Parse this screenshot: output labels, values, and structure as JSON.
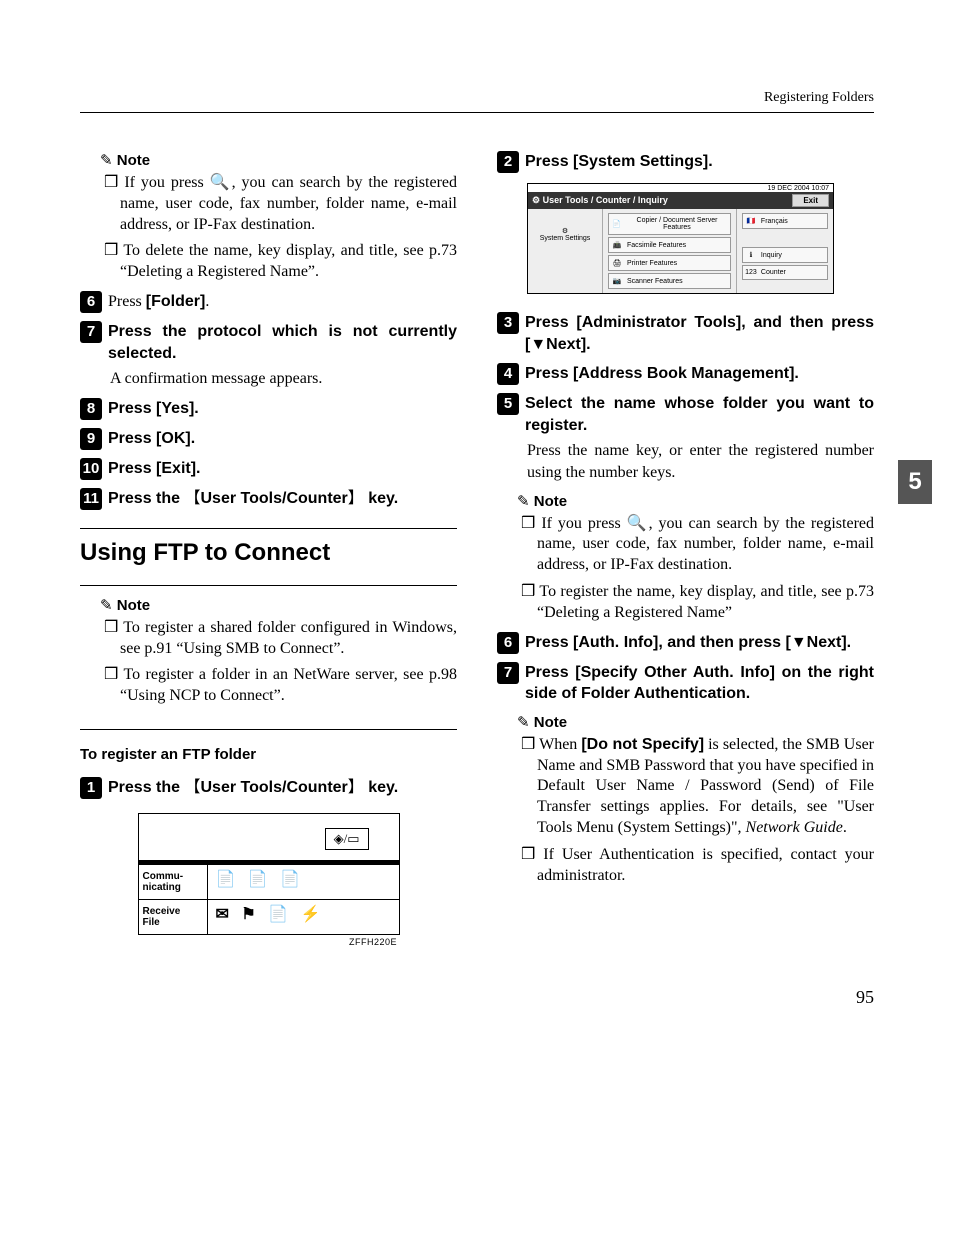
{
  "header": {
    "section": "Registering Folders"
  },
  "sideTab": "5",
  "pageNumber": "95",
  "left": {
    "note1": "Note",
    "note1_b1": "If you press 🔍, you can search by the registered name, user code, fax number, folder name, e-mail address, or IP-Fax destination.",
    "note1_b2": "To delete the name, key display, and title, see p.73 “Deleting a Registered Name”.",
    "s6": {
      "pre": "Press ",
      "btn": "[Folder]",
      "post": "."
    },
    "s7": "Press the protocol which is not currently selected.",
    "s7_after": "A confirmation message appears.",
    "s8": {
      "pre": "Press ",
      "btn": "[Yes]",
      "post": "."
    },
    "s9": {
      "pre": "Press ",
      "btn": "[OK]",
      "post": "."
    },
    "s10": {
      "pre": "Press ",
      "btn": "[Exit]",
      "post": "."
    },
    "s11": {
      "pre": "Press the ",
      "key": "User Tools/Counter",
      "post": " key."
    },
    "h2": "Using FTP to Connect",
    "note2": "Note",
    "note2_b1": "To register a shared folder configured in Windows, see p.91 “Using SMB to Connect”.",
    "note2_b2": "To register a folder in an NetWare server, see p.98 “Using NCP to Connect”.",
    "h3": "To register an FTP folder",
    "s1": {
      "pre": "Press the ",
      "key": "User Tools/Counter",
      "post": " key."
    },
    "illus": {
      "topbtn": "◈/▭",
      "row1_label": "Commu-\nnicating",
      "row1_icons": "📄 📄 📄",
      "row2_label": "Receive\nFile",
      "row2_icons": "✉ ⚑ 📄 ⚡",
      "caption": "ZFFH220E"
    }
  },
  "right": {
    "s2": {
      "pre": "Press ",
      "btn": "[System Settings]",
      "post": "."
    },
    "ss2": {
      "time": "19 DEC 2004 10:07",
      "title": "⚙ User Tools / Counter / Inquiry",
      "exit": "Exit",
      "left_label": "System Settings",
      "mid": [
        {
          "icon": "📄",
          "label": "Copier / Document Server Features"
        },
        {
          "icon": "📠",
          "label": "Facsimile Features"
        },
        {
          "icon": "🖨",
          "label": "Printer Features"
        },
        {
          "icon": "📷",
          "label": "Scanner Features"
        }
      ],
      "right": [
        {
          "icon": "🇫🇷",
          "label": "Français"
        },
        {
          "icon": "ℹ",
          "label": "Inquiry"
        },
        {
          "icon": "123",
          "label": "Counter"
        }
      ]
    },
    "s3": {
      "pre": "Press ",
      "btn": "[Administrator Tools]",
      "mid": ", and then press ",
      "btn2": "[▼Next]",
      "post": "."
    },
    "s4": {
      "pre": "Press ",
      "btn": "[Address Book Management]",
      "post": "."
    },
    "s5": "Select the name whose folder you want to register.",
    "s5_after": "Press the name key, or enter the registered number using the number keys.",
    "note3": "Note",
    "note3_b1": "If you press 🔍, you can search by the registered name, user code, fax number, folder name, e-mail address, or IP-Fax destination.",
    "note3_b2": "To register the name, key display, and title, see p.73 “Deleting a Registered Name”",
    "s6": {
      "pre": "Press ",
      "btn": "[Auth. Info]",
      "mid": ", and then press ",
      "btn2": "[▼Next]",
      "post": "."
    },
    "s7": {
      "pre": "Press ",
      "btn": "[Specify Other Auth. Info]",
      "post": " on the right side of Folder Authentication."
    },
    "note4": "Note",
    "note4_b1a": "When ",
    "note4_b1_bold": "[Do not Specify]",
    "note4_b1b": " is selected, the SMB User Name and SMB Password that you have specified in Default User Name / Password (Send) of File Transfer settings applies. For details, see \"User Tools Menu (System Settings)\", ",
    "note4_b1_italic": "Network Guide",
    "note4_b1c": ".",
    "note4_b2": "If User Authentication is specified, contact your administrator."
  }
}
